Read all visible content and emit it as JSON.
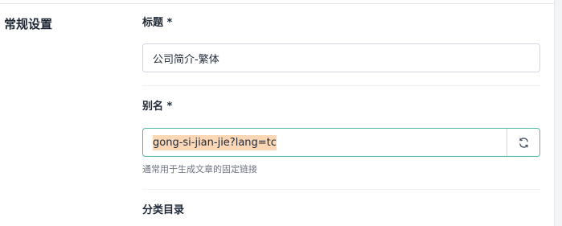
{
  "section": {
    "title": "常规设置"
  },
  "fields": {
    "title": {
      "label": "标题 *",
      "value": "公司简介-繁体"
    },
    "alias": {
      "label": "别名 *",
      "value": "gong-si-jian-jie?lang=tc",
      "help": "通常用于生成文章的固定链接",
      "action_icon": "refresh-icon"
    },
    "category": {
      "label": "分类目录"
    }
  },
  "colors": {
    "focus_border": "#4fb8a8",
    "text_selection": "#fbd7b5",
    "help_text": "#6b7280"
  }
}
